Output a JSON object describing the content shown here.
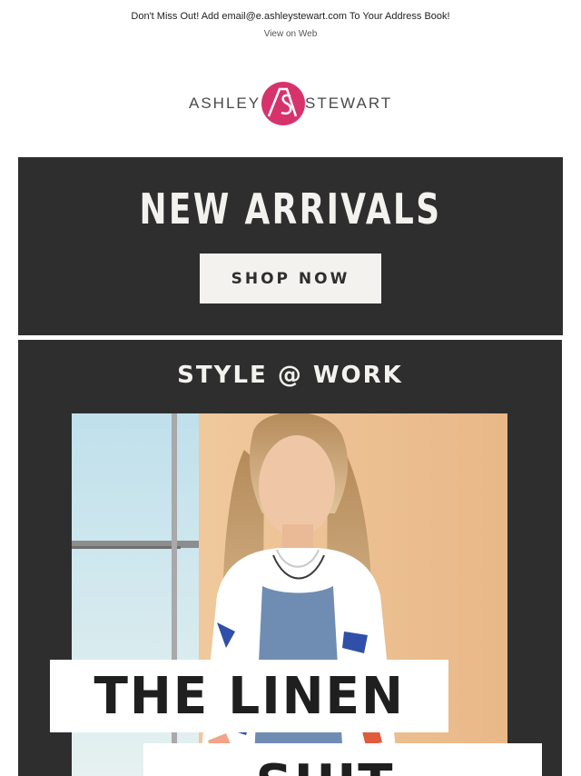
{
  "preheader": {
    "text": "Don't Miss Out! Add email@e.ashleystewart.com To Your Address Book!",
    "view_on_web": "View on Web"
  },
  "logo": {
    "left_word": "ASHLEY",
    "right_word": "STEWART",
    "mark": "AS",
    "brand_color": "#d6336c"
  },
  "new_arrivals": {
    "title": "NEW ARRIVALS",
    "cta": "SHOP NOW"
  },
  "style_work": {
    "title": "STYLE @ WORK",
    "headline_line1": "THE LINEN",
    "headline_line2": "SUIT"
  },
  "colors": {
    "banner_bg": "#2e2e2e",
    "banner_text": "#f3f2ee"
  }
}
